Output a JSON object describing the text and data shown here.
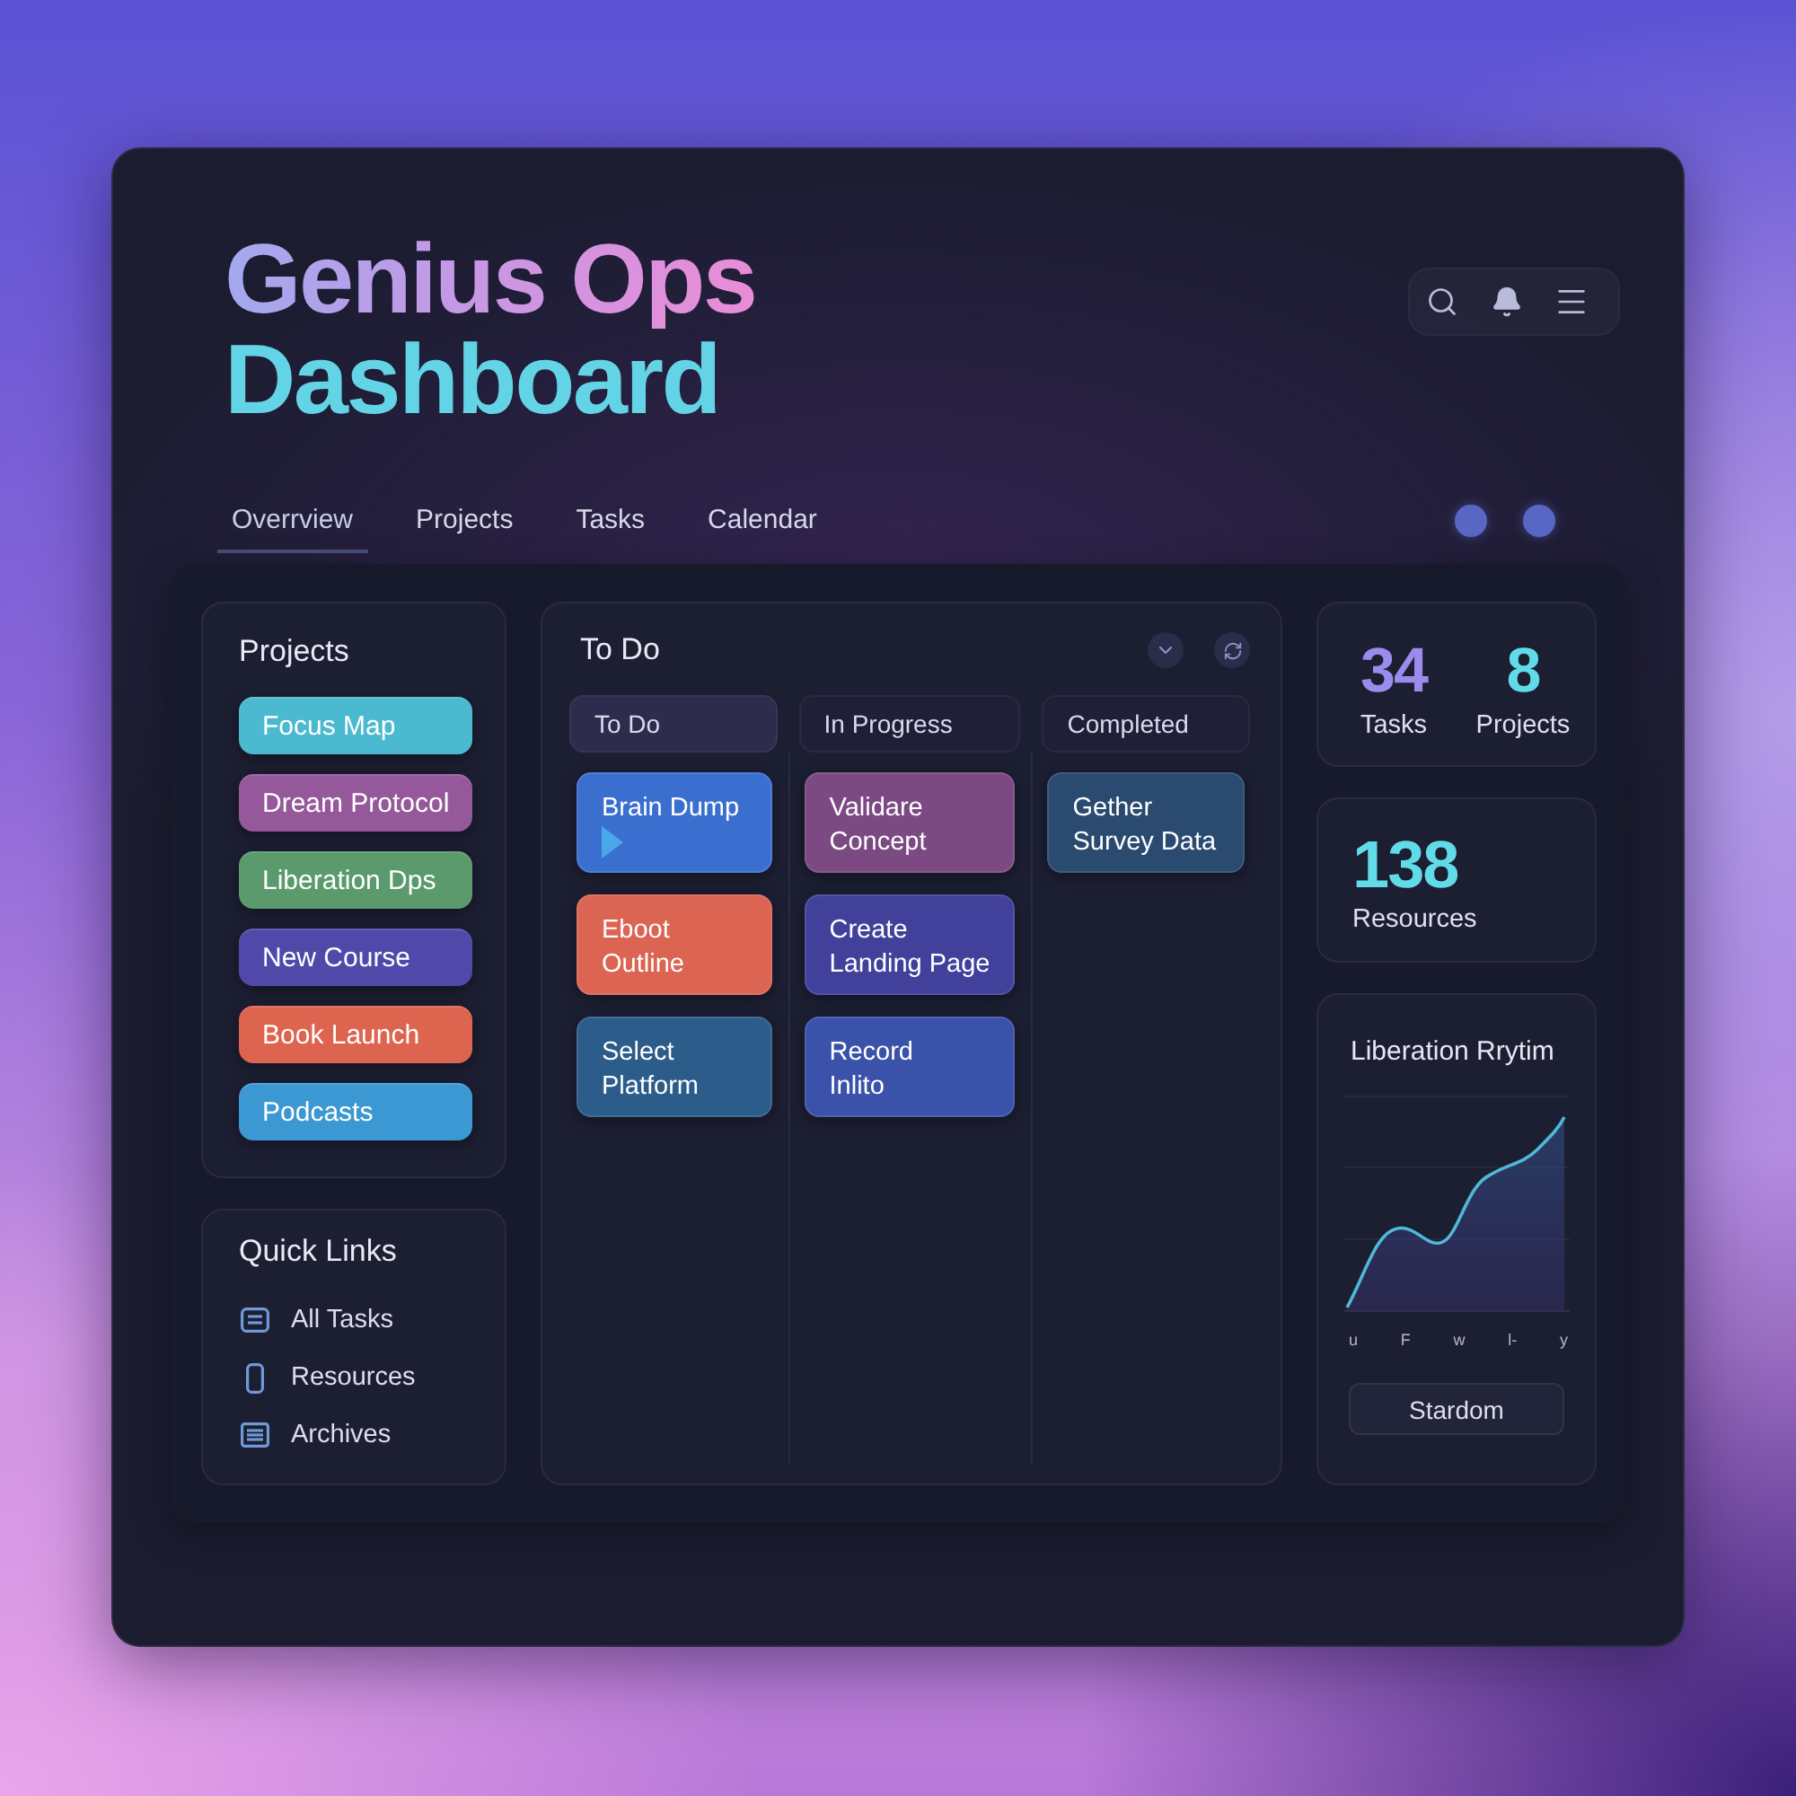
{
  "header": {
    "title": [
      "Genius Ops",
      "Dashboard"
    ]
  },
  "tabs": [
    {
      "label": "Overrview",
      "selected": true
    },
    {
      "label": "Projects",
      "selected": false
    },
    {
      "label": "Tasks",
      "selected": false
    },
    {
      "label": "Calendar",
      "selected": false
    }
  ],
  "projects": {
    "title": "Projects",
    "items": [
      {
        "label": "Focus Map",
        "color": "#4bb9cf"
      },
      {
        "label": "Dream Protocol",
        "color": "#95589a"
      },
      {
        "label": "Liberation Dps",
        "color": "#5a9a6c"
      },
      {
        "label": "New Course",
        "color": "#5149aa"
      },
      {
        "label": "Book Launch",
        "color": "#dd644f"
      },
      {
        "label": "Podcasts",
        "color": "#3b98d2"
      }
    ]
  },
  "quick_links": {
    "title": "Quick Links",
    "items": [
      {
        "label": "All Tasks",
        "kind": "card"
      },
      {
        "label": "Resources",
        "kind": "phone"
      },
      {
        "label": "Archives",
        "kind": "list"
      }
    ]
  },
  "board": {
    "title": "To Do",
    "columns": [
      {
        "title": "To Do",
        "selected": true,
        "cards": [
          {
            "lines": [
              "Brain Dump"
            ],
            "color": "#3b6fcf",
            "kind": "play"
          },
          {
            "lines": [
              "Eboot",
              "Outline"
            ],
            "color": "#dc6452",
            "kind": "plain"
          },
          {
            "lines": [
              "Select",
              "Platform"
            ],
            "color": "#2c5c8a",
            "kind": "plain"
          }
        ]
      },
      {
        "title": "In Progress",
        "selected": false,
        "cards": [
          {
            "lines": [
              "Validare",
              "Concept"
            ],
            "color": "#7b4a82",
            "kind": "plain"
          },
          {
            "lines": [
              "Create",
              "Landing Page"
            ],
            "color": "#41419c",
            "kind": "plain"
          },
          {
            "lines": [
              "Record",
              "Inlito"
            ],
            "color": "#3b52aa",
            "kind": "plain"
          }
        ]
      },
      {
        "title": "Completed",
        "selected": false,
        "cards": [
          {
            "lines": [
              "Gether",
              "Survey Data"
            ],
            "color": "#2a4a70",
            "kind": "plain"
          }
        ]
      }
    ]
  },
  "stat_cards": [
    {
      "items": [
        {
          "value": "34",
          "label": "Tasks",
          "color": "#9b8cec"
        },
        {
          "value": "8",
          "label": "Projects",
          "color": "#62dbe9"
        }
      ]
    },
    {
      "items": [
        {
          "value": "138",
          "label": "Resources",
          "color": "#62dbe9"
        }
      ]
    }
  ],
  "rhythm": {
    "title": "Liberation Rrytim",
    "axis_labels": [
      "u",
      "F",
      "w",
      "l-",
      "y"
    ],
    "button": "Stardom"
  }
}
